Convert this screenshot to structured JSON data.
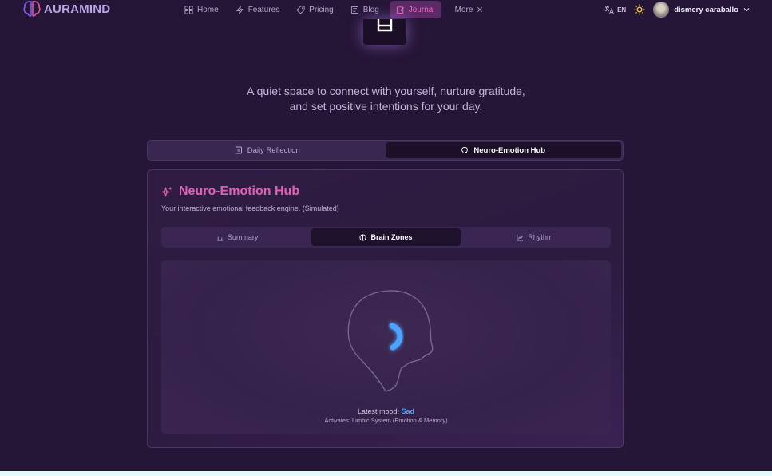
{
  "app": {
    "name": "AURAMIND"
  },
  "nav": {
    "items": [
      {
        "label": "Home",
        "icon": "grid-icon"
      },
      {
        "label": "Features",
        "icon": "bolt-icon"
      },
      {
        "label": "Pricing",
        "icon": "tag-icon"
      },
      {
        "label": "Blog",
        "icon": "newspaper-icon"
      },
      {
        "label": "Journal",
        "icon": "edit-icon",
        "active": true
      }
    ],
    "more_label": "More",
    "language": "EN",
    "user_name": "dismery caraballo"
  },
  "intro": {
    "line1": "A quiet space to connect with yourself, nurture gratitude,",
    "line2": "and set positive intentions for your day."
  },
  "main_tabs": [
    {
      "label": "Daily Reflection",
      "active": false
    },
    {
      "label": "Neuro-Emotion Hub",
      "active": true
    }
  ],
  "hub": {
    "title": "Neuro-Emotion Hub",
    "subtitle": "Your interactive emotional feedback engine. (Simulated)",
    "tabs": [
      {
        "label": "Summary",
        "active": false
      },
      {
        "label": "Brain Zones",
        "active": true
      },
      {
        "label": "Rhythm",
        "active": false
      }
    ],
    "mood_label": "Latest mood:",
    "mood_value": "Sad",
    "activates": "Activates: Limbic System (Emotion & Memory)"
  },
  "colors": {
    "background": "#251536",
    "accent_pink": "#e160b6",
    "mood_blue": "#4ea4ff"
  }
}
